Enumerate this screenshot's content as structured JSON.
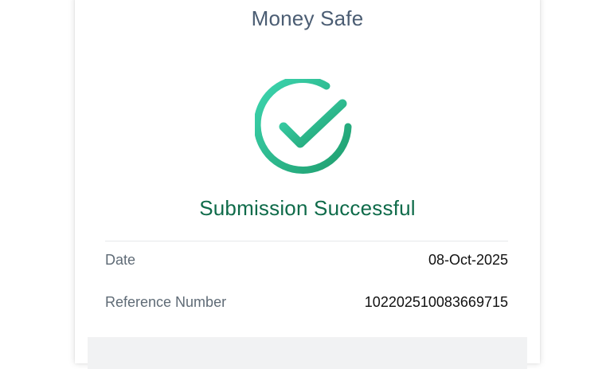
{
  "header": {
    "title": "Money Safe"
  },
  "status": {
    "icon": "check-circle-icon",
    "message": "Submission Successful",
    "color": "#0f6b4a",
    "icon_gradient_start": "#3dd6b0",
    "icon_gradient_end": "#1f9e6e"
  },
  "details": {
    "date_label": "Date",
    "date_value": "08-Oct-2025",
    "reference_label": "Reference Number",
    "reference_value": "102202510083669715"
  }
}
